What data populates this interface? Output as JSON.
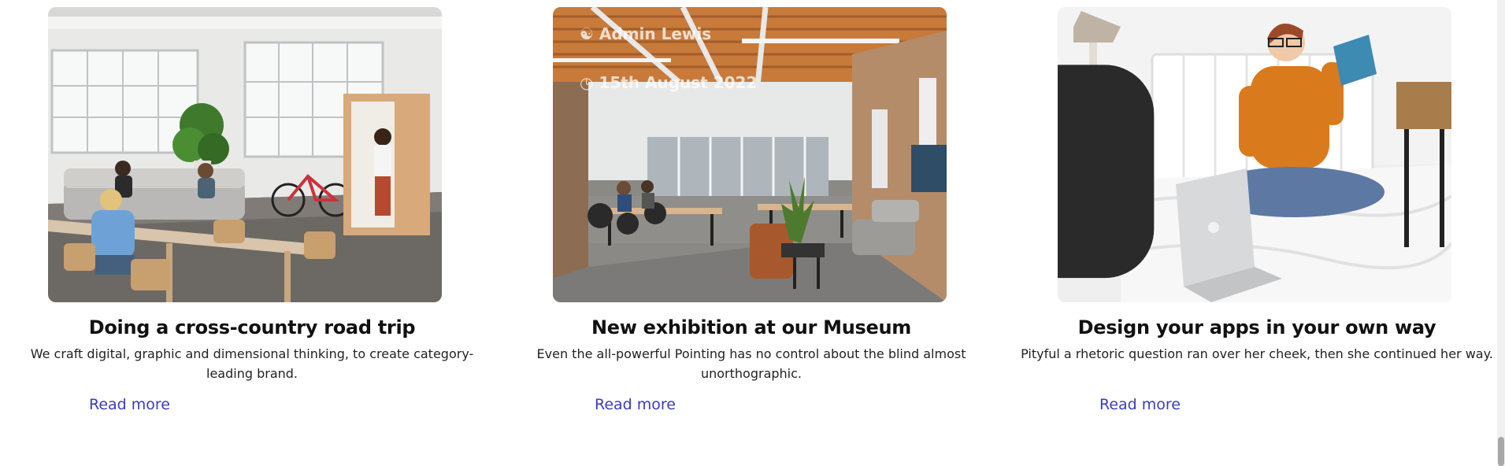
{
  "cards": [
    {
      "title": "Doing a cross-country road trip",
      "description": "We craft digital, graphic and dimensional thinking, to create category-leading brand.",
      "read_more": "Read more",
      "image": "open-office-lounge-photo"
    },
    {
      "title": "New exhibition at our Museum",
      "description": "Even the all-powerful Pointing has no control about the blind almost unorthographic.",
      "read_more": "Read more",
      "image": "industrial-office-workspace-photo",
      "overlay_author": "Admin Lewis",
      "overlay_date": "15th August 2022"
    },
    {
      "title": "Design your apps in your own way",
      "description": "Pityful a rhetoric question ran over her cheek, then she continued her way.",
      "read_more": "Read more",
      "image": "woman-reading-on-bed-photo"
    }
  ],
  "colors": {
    "link": "#3b3bc0",
    "title": "#111111",
    "text": "#222222"
  }
}
